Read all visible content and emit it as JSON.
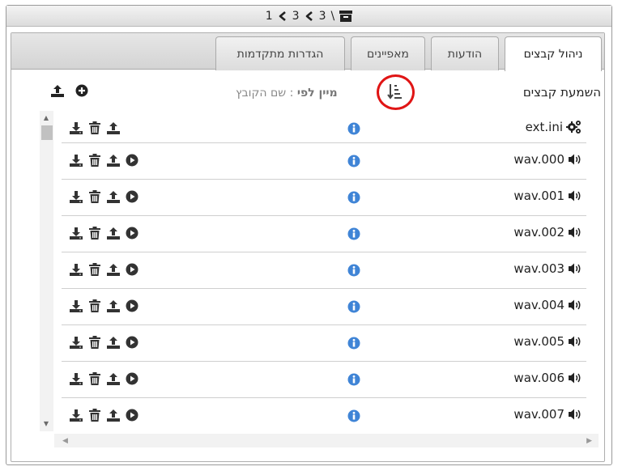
{
  "breadcrumb": {
    "root_icon": "archive-icon",
    "separator": "\\",
    "segments": [
      "3",
      "3",
      "1"
    ],
    "separator_icon": "chevron-left-icon"
  },
  "tabs": [
    {
      "label": "ניהול קבצים",
      "active": true
    },
    {
      "label": "הודעות",
      "active": false
    },
    {
      "label": "מאפיינים",
      "active": false
    },
    {
      "label": "הגדרות מתקדמות",
      "active": false
    }
  ],
  "toolbar": {
    "title": "השמעת קבצים",
    "sort_prefix": "מיין לפי",
    "sort_value": ": שם הקובץ",
    "sort_icon": "sort-ascending-icon",
    "upload_icon": "upload-icon",
    "add_icon": "plus-circle-icon"
  },
  "files": [
    {
      "name": "ext.ini",
      "type_icon": "gears-icon",
      "has_play": false
    },
    {
      "name": "wav.000",
      "type_icon": "speaker-icon",
      "has_play": true
    },
    {
      "name": "wav.001",
      "type_icon": "speaker-icon",
      "has_play": true
    },
    {
      "name": "wav.002",
      "type_icon": "speaker-icon",
      "has_play": true
    },
    {
      "name": "wav.003",
      "type_icon": "speaker-icon",
      "has_play": true
    },
    {
      "name": "wav.004",
      "type_icon": "speaker-icon",
      "has_play": true
    },
    {
      "name": "wav.005",
      "type_icon": "speaker-icon",
      "has_play": true
    },
    {
      "name": "wav.006",
      "type_icon": "speaker-icon",
      "has_play": true
    },
    {
      "name": "wav.007",
      "type_icon": "speaker-icon",
      "has_play": true
    }
  ],
  "colors": {
    "info_blue": "#3f84d6",
    "highlight_red": "#e01515",
    "icon_dark": "#333333"
  }
}
